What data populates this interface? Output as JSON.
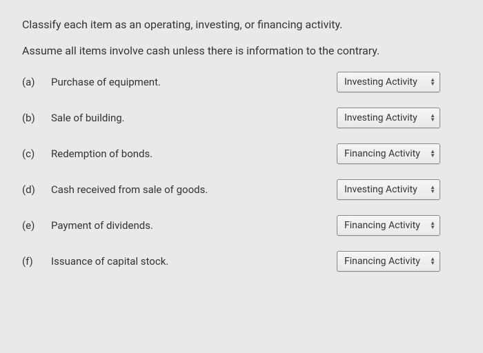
{
  "instructions": {
    "line1": "Classify each item as an operating, investing, or financing activity.",
    "line2": "Assume all items involve cash unless there is information to the contrary."
  },
  "questions": [
    {
      "letter": "(a)",
      "text": "Purchase of equipment.",
      "selected": "Investing Activity"
    },
    {
      "letter": "(b)",
      "text": "Sale of building.",
      "selected": "Investing Activity"
    },
    {
      "letter": "(c)",
      "text": "Redemption of bonds.",
      "selected": "Financing Activity"
    },
    {
      "letter": "(d)",
      "text": "Cash received from sale of goods.",
      "selected": "Investing Activity"
    },
    {
      "letter": "(e)",
      "text": "Payment of dividends.",
      "selected": "Financing Activity"
    },
    {
      "letter": "(f)",
      "text": "Issuance of capital stock.",
      "selected": "Financing Activity"
    }
  ]
}
